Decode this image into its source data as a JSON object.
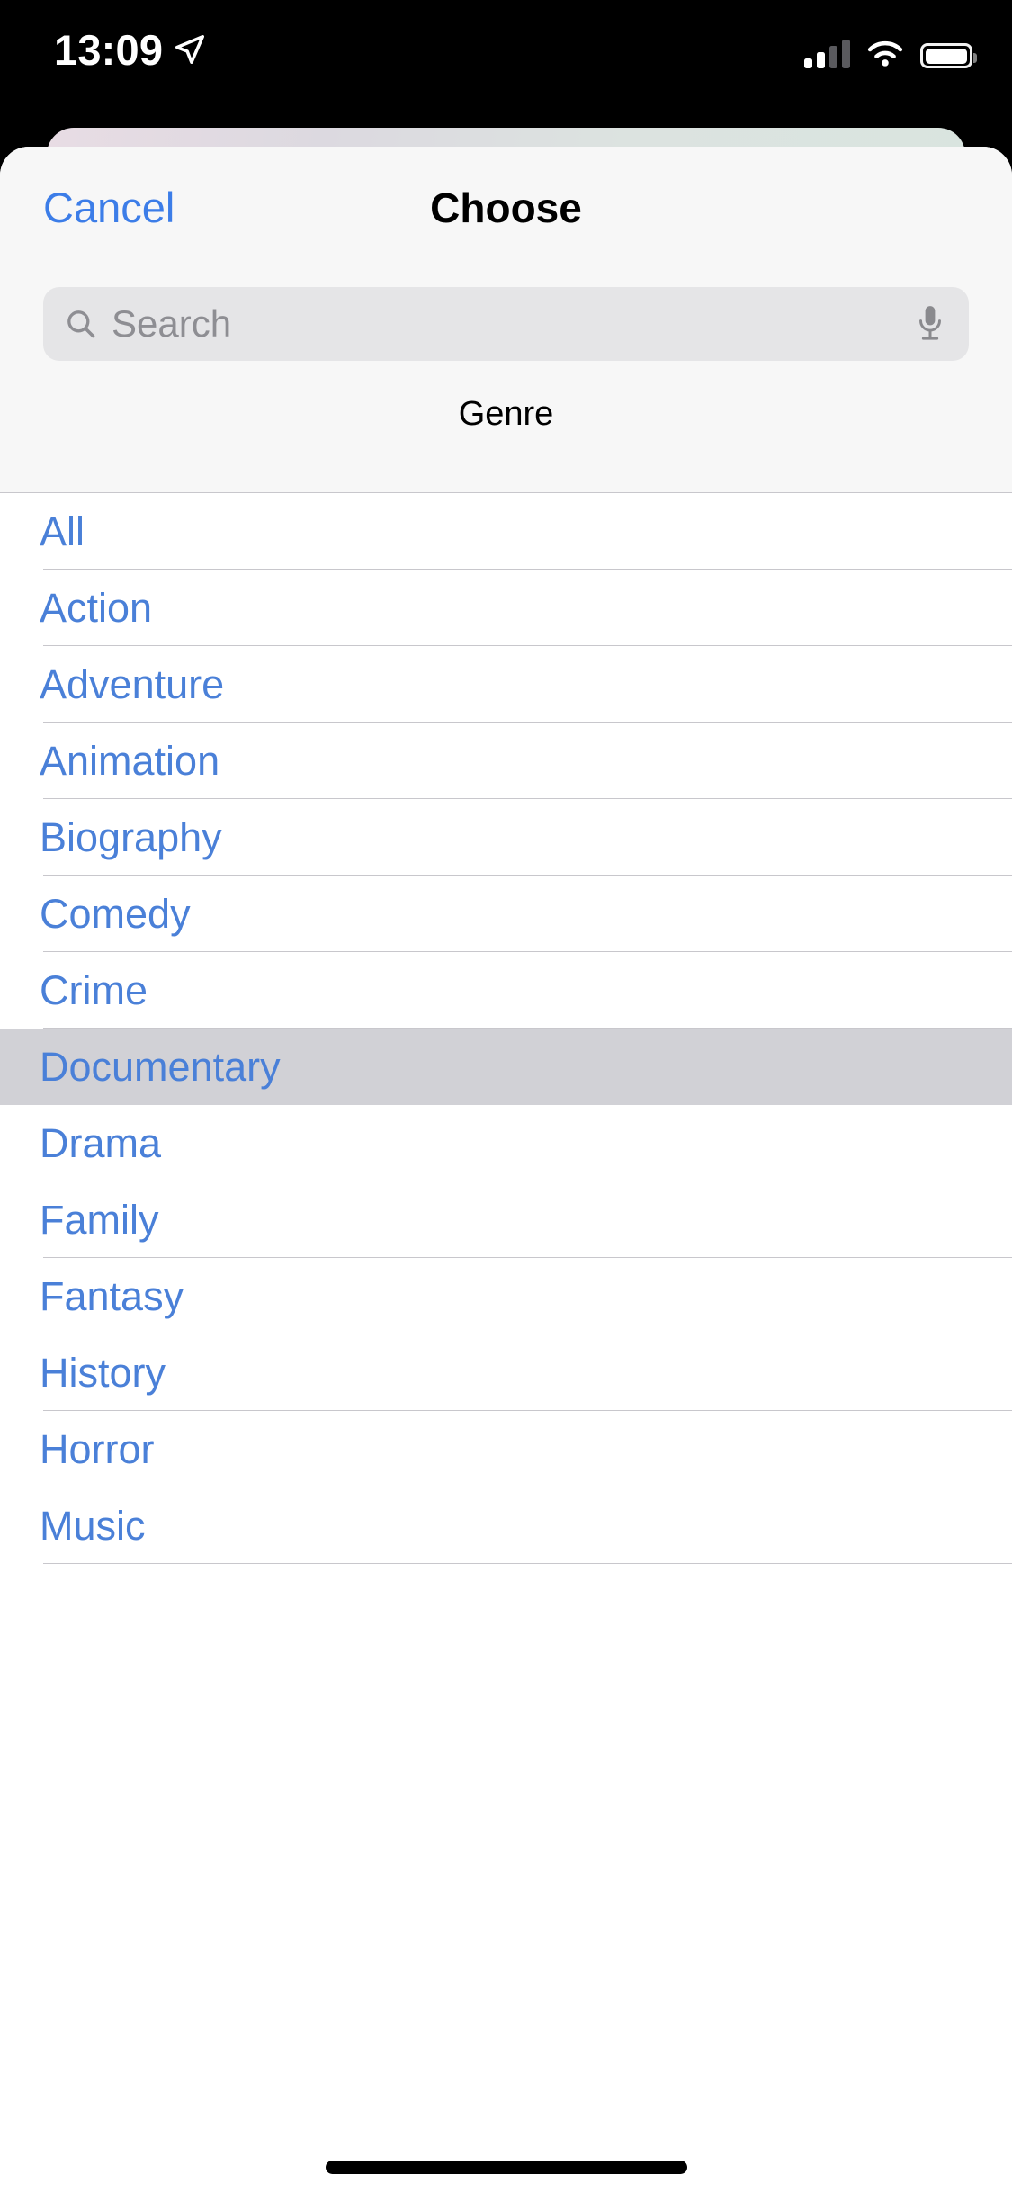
{
  "status_bar": {
    "time": "13:09",
    "location_icon": "location-arrow-icon",
    "cellular_icon": "cellular-signal-icon",
    "cellular_bars_filled": 2,
    "cellular_bars_total": 4,
    "wifi_icon": "wifi-icon",
    "battery_icon": "battery-icon",
    "battery_level_percent": 90
  },
  "background_card": {
    "gradient_from": "#E8DCE4",
    "gradient_to": "#D9E4DF"
  },
  "sheet": {
    "title": "Choose",
    "cancel_label": "Cancel",
    "accent_color": "#3C7DE8",
    "header_background": "#F7F7F7"
  },
  "search": {
    "placeholder": "Search",
    "value": "",
    "search_icon": "search-icon",
    "mic_icon": "microphone-icon",
    "field_background": "#E5E5E7"
  },
  "section": {
    "header": "Genre"
  },
  "list": {
    "selected": "Documentary",
    "selected_background": "#D1D1D6",
    "item_color": "#4A80D8",
    "items": [
      {
        "label": "All",
        "selected": false
      },
      {
        "label": "Action",
        "selected": false
      },
      {
        "label": "Adventure",
        "selected": false
      },
      {
        "label": "Animation",
        "selected": false
      },
      {
        "label": "Biography",
        "selected": false
      },
      {
        "label": "Comedy",
        "selected": false
      },
      {
        "label": "Crime",
        "selected": false
      },
      {
        "label": "Documentary",
        "selected": true
      },
      {
        "label": "Drama",
        "selected": false
      },
      {
        "label": "Family",
        "selected": false
      },
      {
        "label": "Fantasy",
        "selected": false
      },
      {
        "label": "History",
        "selected": false
      },
      {
        "label": "Horror",
        "selected": false
      },
      {
        "label": "Music",
        "selected": false
      }
    ]
  },
  "home_indicator": {
    "visible": true
  }
}
